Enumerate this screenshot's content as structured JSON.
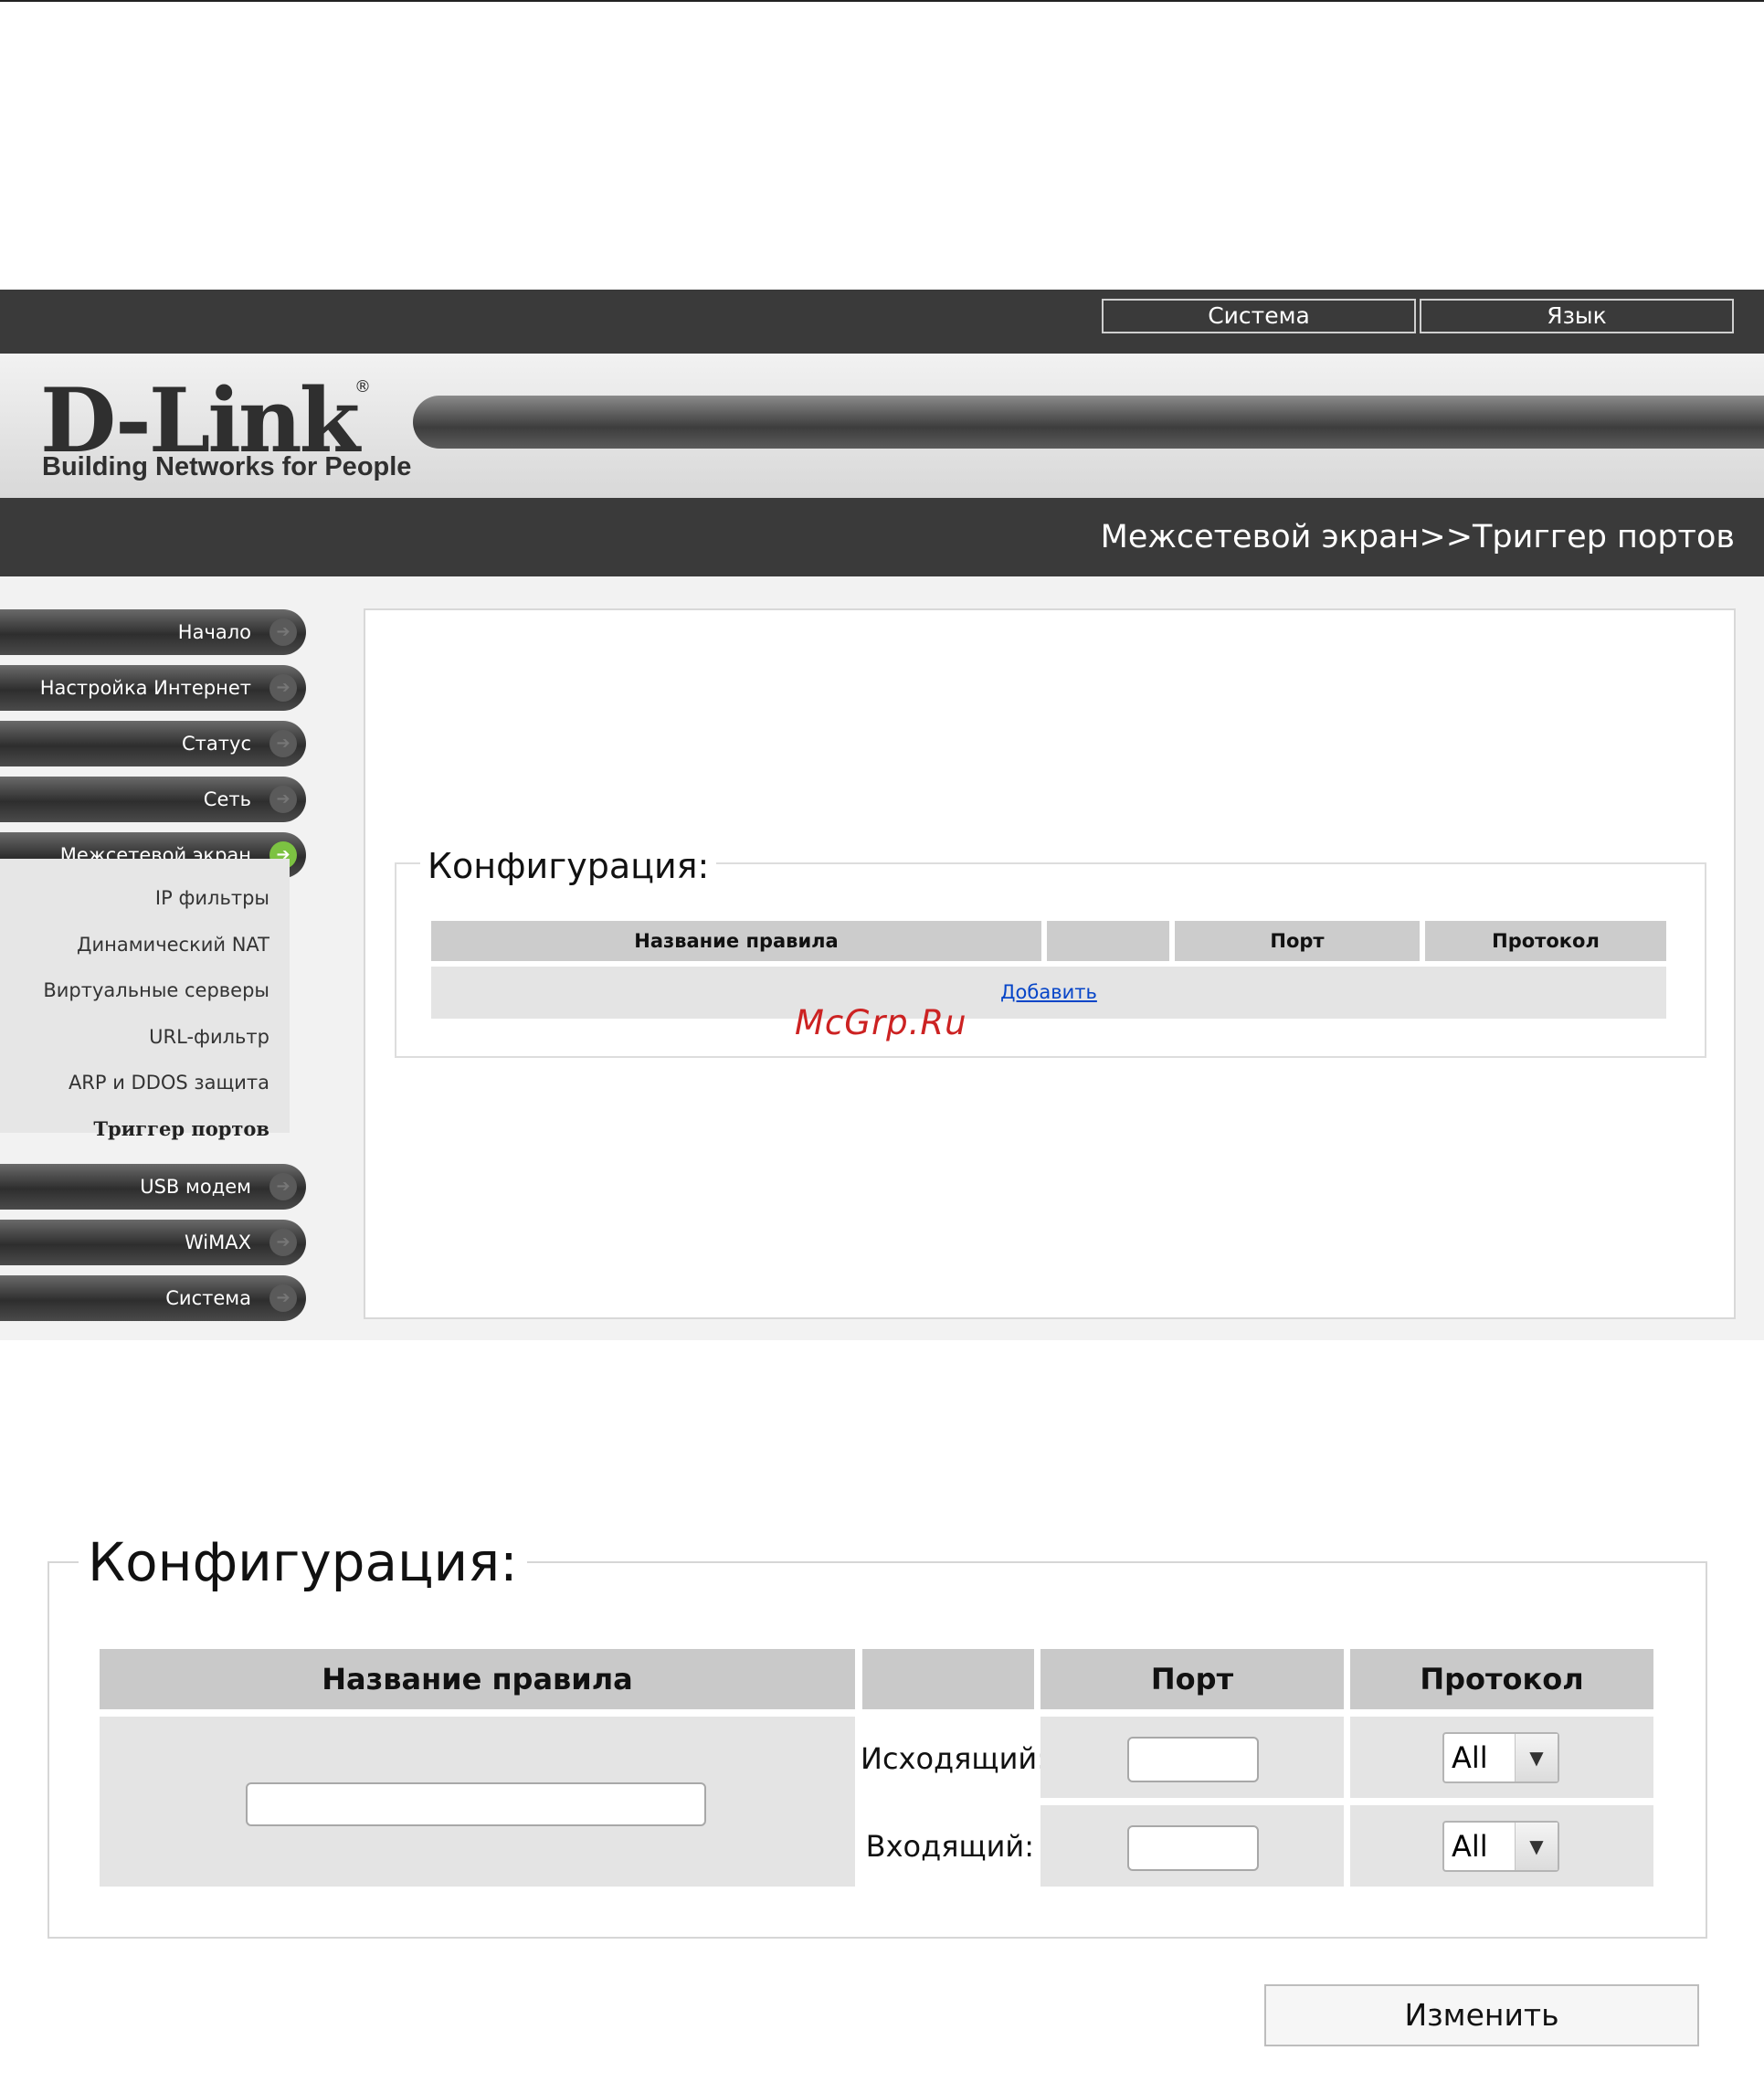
{
  "header": {
    "top_buttons": [
      "Система",
      "Язык"
    ],
    "logo_text": "D-Link",
    "logo_tagline": "Building Networks for People",
    "breadcrumb": "Межсетевой экран>>Триггер портов"
  },
  "sidebar": {
    "items": [
      {
        "label": "Начало"
      },
      {
        "label": "Настройка Интернет"
      },
      {
        "label": "Статус"
      },
      {
        "label": "Сеть"
      },
      {
        "label": "Межсетевой экран",
        "active": true
      },
      {
        "label": "USB модем"
      },
      {
        "label": "WiMAX"
      },
      {
        "label": "Система"
      }
    ],
    "subitems": [
      "IP фильтры",
      "Динамический NAT",
      "Виртуальные серверы",
      "URL-фильтр",
      "ARP и DDOS защита",
      "Триггер портов"
    ],
    "current_subitem": "Триггер портов"
  },
  "config": {
    "legend": "Конфигурация:",
    "headers": [
      "Название правила",
      "",
      "Порт",
      "Протокол"
    ],
    "add_link": "Добавить"
  },
  "watermark": "McGrp.Ru",
  "detail": {
    "legend": "Конфигурация:",
    "headers": [
      "Название правила",
      "",
      "Порт",
      "Протокол"
    ],
    "outgoing_label": "Исходящий:",
    "incoming_label": "Входящий:",
    "rule_name_value": "",
    "outgoing_port_value": "",
    "incoming_port_value": "",
    "outgoing_protocol": "All",
    "incoming_protocol": "All",
    "submit_label": "Изменить"
  },
  "icons": {
    "nav_arrow": "arrow-right-circle-icon",
    "select_caret": "chevron-down-icon"
  },
  "colors": {
    "active_nav_icon": "#7cc242",
    "link": "#0645c8",
    "watermark": "#cc2222"
  }
}
